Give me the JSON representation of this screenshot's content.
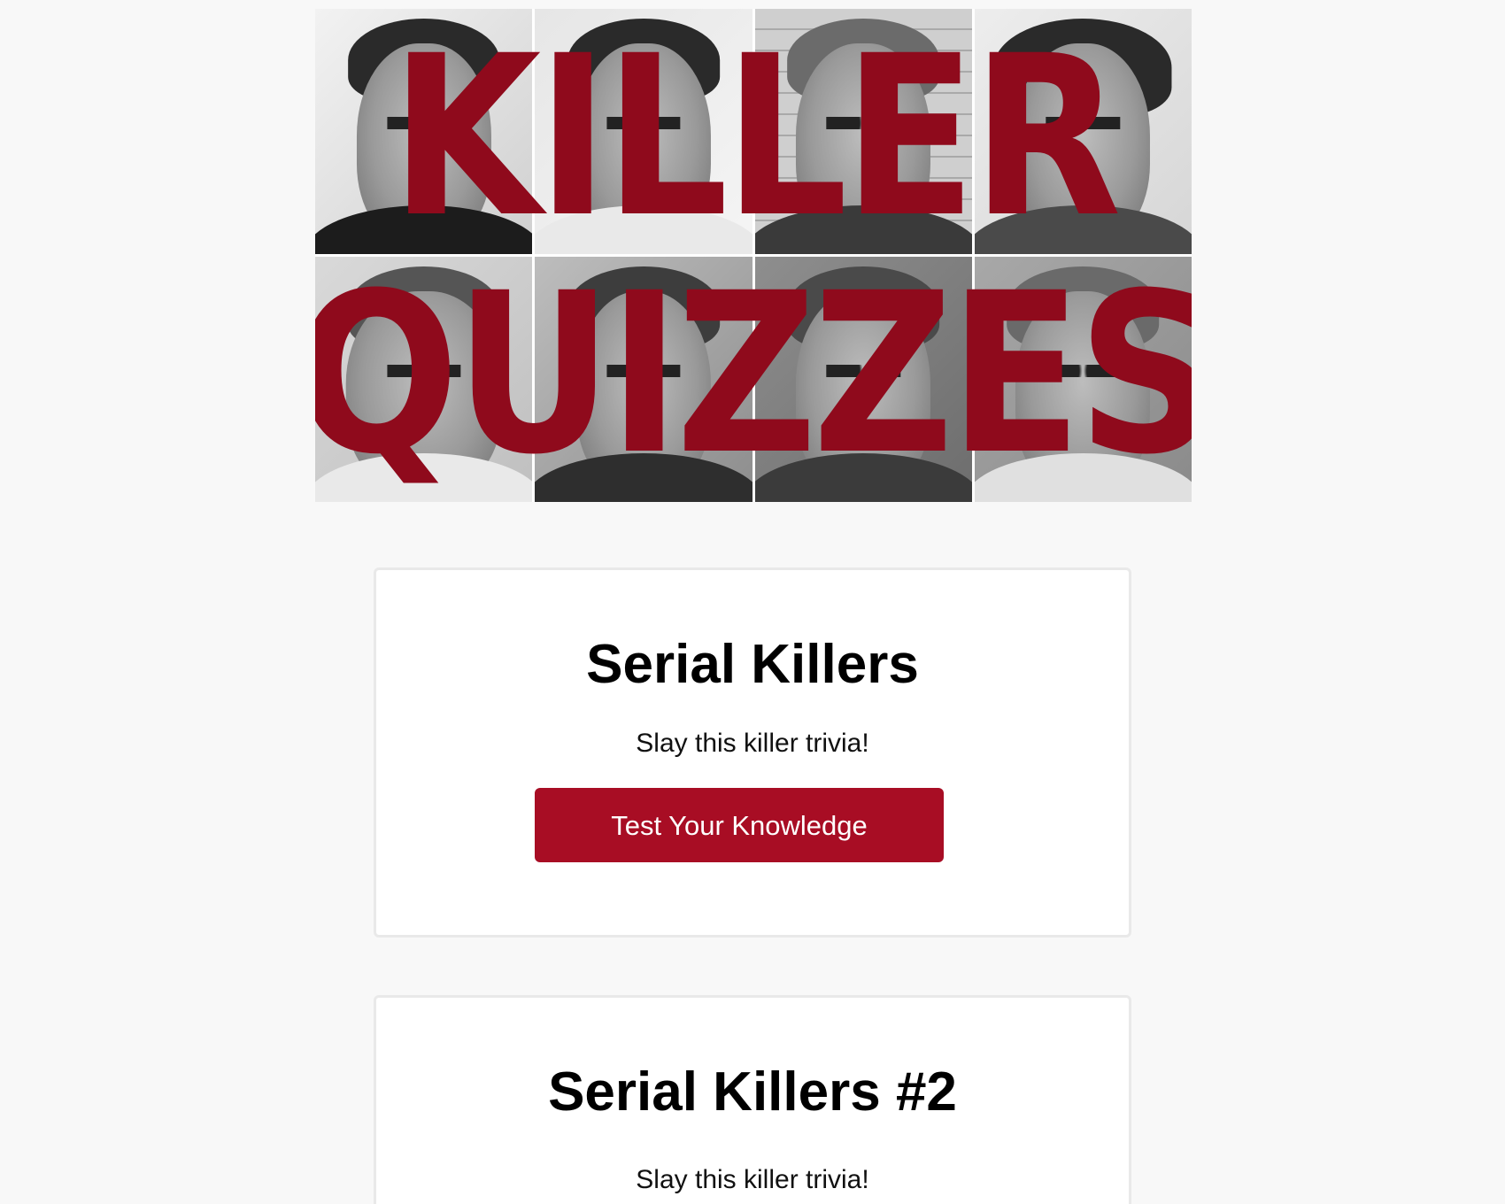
{
  "banner": {
    "line1": "KILLER",
    "line2": "QUIZZES",
    "title_color": "#8f0a1c"
  },
  "quizzes": [
    {
      "title": "Serial Killers",
      "description": "Slay this killer trivia!",
      "button_label": "Test Your Knowledge"
    },
    {
      "title": "Serial Killers #2",
      "description": "Slay this killer trivia!"
    }
  ],
  "colors": {
    "background": "#f8f8f8",
    "button": "#a80d24",
    "card_border": "#e9e9e9"
  }
}
